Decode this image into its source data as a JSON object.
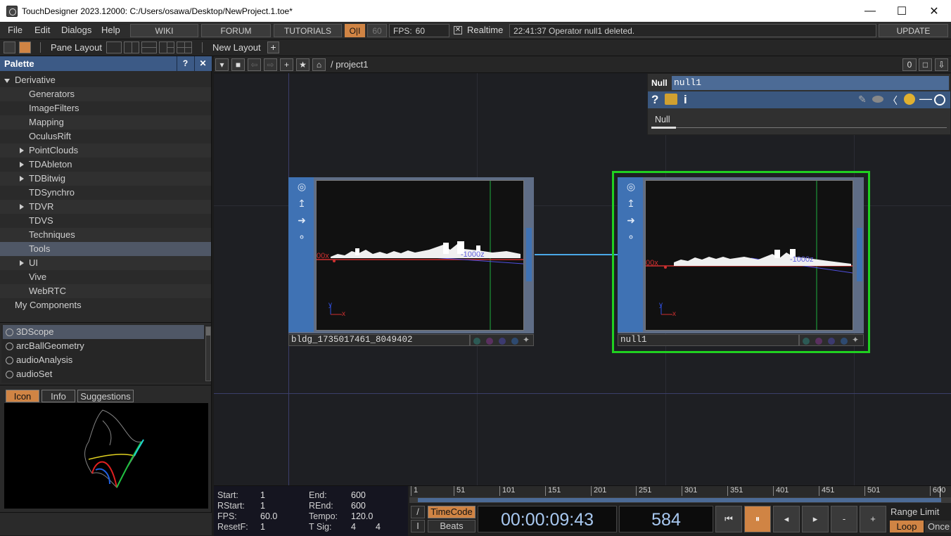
{
  "window": {
    "title": "TouchDesigner 2023.12000: C:/Users/osawa/Desktop/NewProject.1.toe*",
    "minimize": "—",
    "maximize": "☐",
    "close": "✕"
  },
  "menu": {
    "items": [
      "File",
      "Edit",
      "Dialogs",
      "Help"
    ],
    "links": [
      "WIKI",
      "FORUM",
      "TUTORIALS"
    ],
    "oi": "O|I",
    "fps_cap": "60",
    "fps_label": "FPS:",
    "fps_value": "60",
    "realtime_check": "✕",
    "realtime_label": "Realtime",
    "status": "22:41:37 Operator null1 deleted.",
    "update": "UPDATE"
  },
  "panebar": {
    "pane_layout": "Pane Layout",
    "new_layout": "New Layout",
    "add": "+"
  },
  "palette": {
    "title": "Palette",
    "help": "?",
    "close": "✕",
    "tree": [
      {
        "label": "Derivative",
        "indent": 0,
        "expander": "open"
      },
      {
        "label": "Generators",
        "indent": 2,
        "expander": "none"
      },
      {
        "label": "ImageFilters",
        "indent": 2,
        "expander": "none"
      },
      {
        "label": "Mapping",
        "indent": 2,
        "expander": "none"
      },
      {
        "label": "OculusRift",
        "indent": 2,
        "expander": "none"
      },
      {
        "label": "PointClouds",
        "indent": 2,
        "expander": "closed"
      },
      {
        "label": "TDAbleton",
        "indent": 2,
        "expander": "closed"
      },
      {
        "label": "TDBitwig",
        "indent": 2,
        "expander": "closed"
      },
      {
        "label": "TDSynchro",
        "indent": 2,
        "expander": "none"
      },
      {
        "label": "TDVR",
        "indent": 2,
        "expander": "closed"
      },
      {
        "label": "TDVS",
        "indent": 2,
        "expander": "none"
      },
      {
        "label": "Techniques",
        "indent": 2,
        "expander": "none"
      },
      {
        "label": "Tools",
        "indent": 2,
        "expander": "none",
        "selected": true
      },
      {
        "label": "UI",
        "indent": 2,
        "expander": "closed"
      },
      {
        "label": "Vive",
        "indent": 2,
        "expander": "none"
      },
      {
        "label": "WebRTC",
        "indent": 2,
        "expander": "none"
      },
      {
        "label": "My Components",
        "indent": 1,
        "expander": "none"
      }
    ],
    "components": [
      "3DScope",
      "arcBallGeometry",
      "audioAnalysis",
      "audioSet"
    ],
    "tabs": [
      "Icon",
      "Info",
      "Suggestions"
    ]
  },
  "network": {
    "path": "/ project1",
    "counter": "0",
    "node1": {
      "name": "bldg_1735017461_8049402",
      "label_left": "00x",
      "label_axis": "-1000z",
      "axis_y": "y",
      "axis_x": "x"
    },
    "node2": {
      "name": "null1",
      "label_left": "00x",
      "label_axis": "-1000z",
      "axis_y": "y",
      "axis_x": "x"
    }
  },
  "params": {
    "type": "Null",
    "name": "null1",
    "help_q": "?",
    "info_i": "i",
    "page_tab": "Null"
  },
  "timeline": {
    "start_label": "Start:",
    "start": "1",
    "end_label": "End:",
    "end": "600",
    "rstart_label": "RStart:",
    "rstart": "1",
    "rend_label": "REnd:",
    "rend": "600",
    "fps_label": "FPS:",
    "fps": "60.0",
    "tempo_label": "Tempo:",
    "tempo": "120.0",
    "resetf_label": "ResetF:",
    "resetf": "1",
    "tsig_label": "T Sig:",
    "tsig_a": "4",
    "tsig_b": "4",
    "ticks": [
      "1",
      "51",
      "101",
      "151",
      "201",
      "251",
      "301",
      "351",
      "401",
      "451",
      "501",
      "600"
    ],
    "slash": "/",
    "bar": "I",
    "timecode_btn": "TimeCode",
    "beats_btn": "Beats",
    "timecode": "00:00:09:43",
    "frame": "584",
    "btn_start": "⏮",
    "btn_pause": "⏸",
    "btn_back": "◂",
    "btn_fwd": "▸",
    "btn_minus": "-",
    "btn_plus": "+",
    "range_limit": "Range Limit",
    "loop": "Loop",
    "once": "Once"
  },
  "colors": {
    "accent_orange": "#d08444",
    "node_blue": "#3f72b4",
    "selected_green": "#20d020",
    "palette_header": "#3c5a86",
    "wire": "#4aa8e8"
  }
}
